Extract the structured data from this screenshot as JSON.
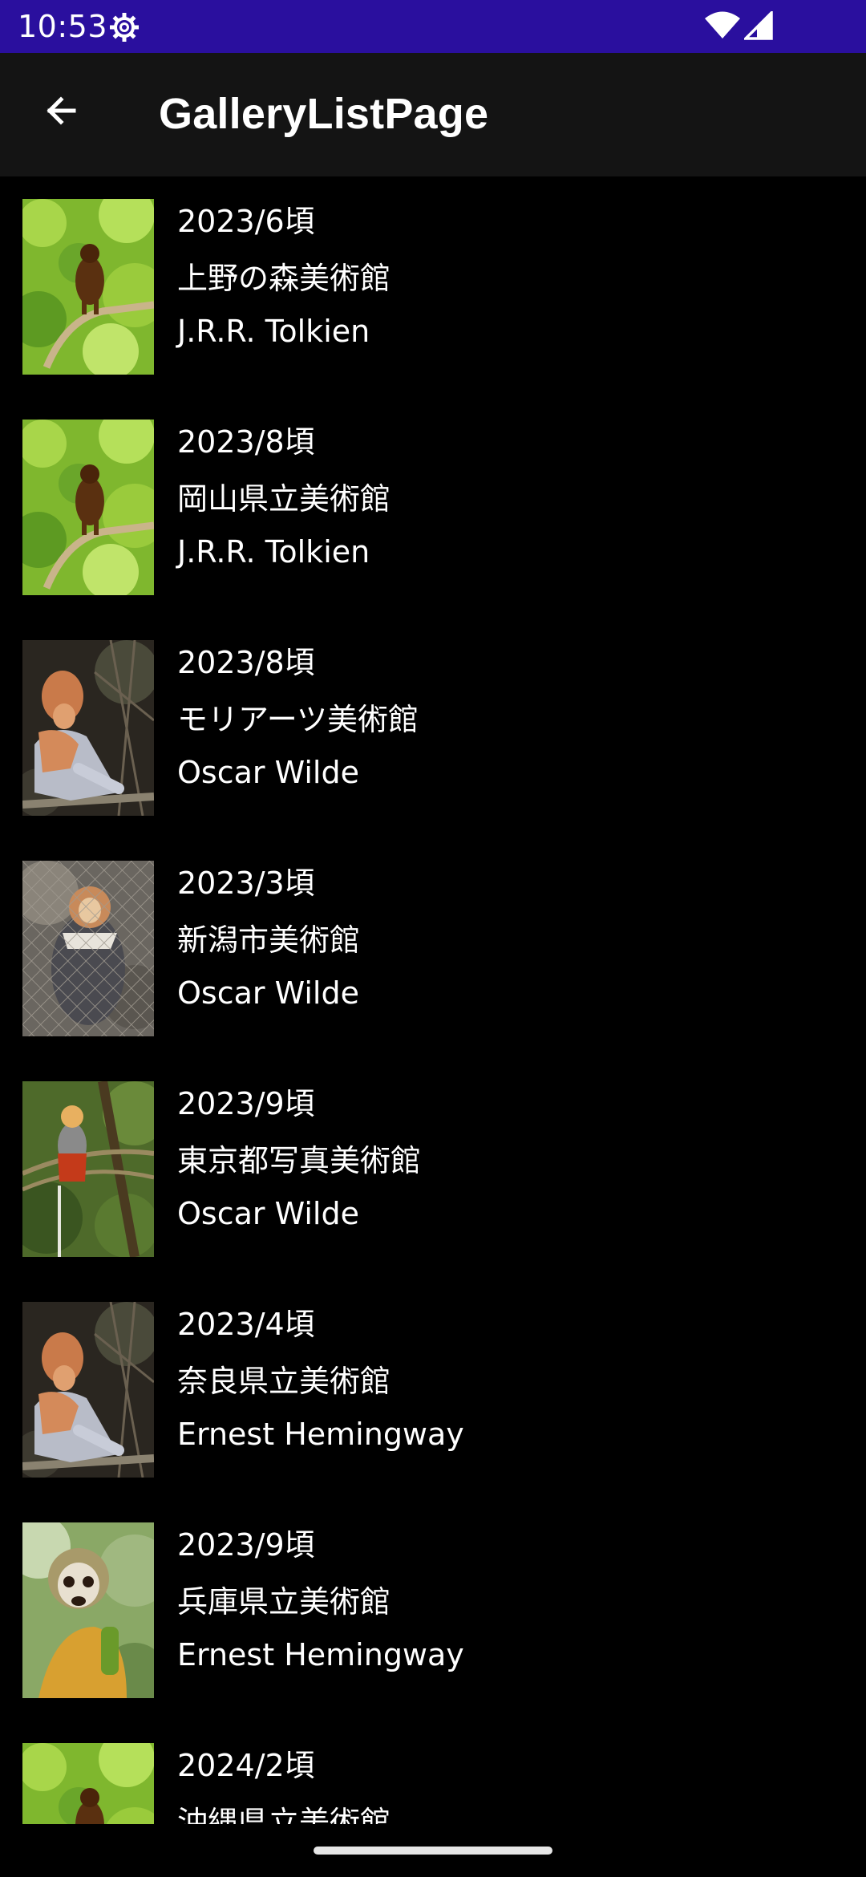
{
  "status_bar": {
    "time": "10:53",
    "icons": [
      "gear-icon",
      "wifi-icon",
      "signal-icon"
    ],
    "background": "#2a0f9e"
  },
  "app_bar": {
    "title": "GalleryListPage",
    "back_icon": "back-arrow-icon",
    "background": "#141414"
  },
  "items": [
    {
      "date": "2023/6頃",
      "museum": "上野の森美術館",
      "author": "J.R.R. Tolkien",
      "thumb": "howler-monkey"
    },
    {
      "date": "2023/8頃",
      "museum": "岡山県立美術館",
      "author": "J.R.R. Tolkien",
      "thumb": "howler-monkey"
    },
    {
      "date": "2023/8頃",
      "museum": "モリアーツ美術館",
      "author": "Oscar Wilde",
      "thumb": "proboscis-monkey"
    },
    {
      "date": "2023/3頃",
      "museum": "新潟市美術館",
      "author": "Oscar Wilde",
      "thumb": "douc-langur"
    },
    {
      "date": "2023/9頃",
      "museum": "東京都写真美術館",
      "author": "Oscar Wilde",
      "thumb": "red-shanked-douc"
    },
    {
      "date": "2023/4頃",
      "museum": "奈良県立美術館",
      "author": "Ernest Hemingway",
      "thumb": "proboscis-monkey"
    },
    {
      "date": "2023/9頃",
      "museum": "兵庫県立美術館",
      "author": "Ernest Hemingway",
      "thumb": "squirrel-monkey"
    },
    {
      "date": "2024/2頃",
      "museum": "沖縄県立美術館",
      "author": "",
      "thumb": "howler-monkey"
    }
  ]
}
